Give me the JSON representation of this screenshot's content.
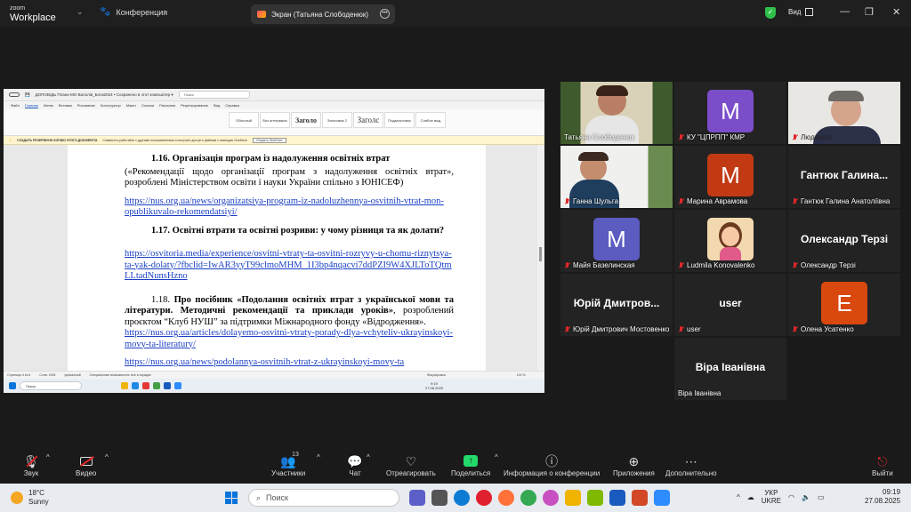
{
  "titlebar": {
    "brand_line1": "zoom",
    "brand_line2": "Workplace",
    "conference_tab": "Конференция",
    "share_tab": "Экран (Татьяна Слободенюк)",
    "view_label": "Вид"
  },
  "word": {
    "title": "ДОПОВІДЬ Плани МО Валолів_Блок2024 • Сохранено в этот компьютер ▾",
    "search": "Поиск",
    "tabs": [
      "Файл",
      "Главная",
      "Меню",
      "Вставка",
      "Рисование",
      "Конструктор",
      "Макет",
      "Ссылки",
      "Рассылки",
      "Рецензирование",
      "Вид",
      "Справка"
    ],
    "active_tab": "Главная",
    "styles": [
      "Обычный",
      "Без интервала",
      "Заголо",
      "Заголовок 2",
      "Заголс",
      "Подзаголовок",
      "Слабое выд"
    ],
    "banner_bold": "СОЗДАТЬ РЕЗЕРВНУЮ КОПИЮ ЭТОГО ДОКУМЕНТА",
    "banner_text": "Совместно работайте с другими пользователями и получите доступ к файлам с помощью OneDrive",
    "banner_btn": "Открыть OneDrive",
    "status_left": "Страница 4 из 6",
    "status_words": "Слов: 1905",
    "status_lang": "украинский",
    "status_access": "Специальные возможности: все в порядке",
    "status_focus": "Фокусировка",
    "status_zoom": "100 %",
    "inner_search": "Поиск",
    "inner_time": "9:19",
    "inner_date": "27.08.2025",
    "doc": {
      "h16": "1.16. Організація програм із надолуження освітніх втрат",
      "p16": "(«Рекомендації щодо організації програм з надолуження освітніх втрат», розроблені Міністерством освіти і науки України спільно з ЮНІСЕФ)",
      "l16": "https://nus.org.ua/news/organizatsiya-program-iz-nadoluzhennya-osvitnih-vtrat-mon-opublikuvalo-rekomendatsiyi/",
      "h17": "1.17. Освітні втрати та освітні розриви: у чому різниця та як долати?",
      "l17": "https://osvitoria.media/experience/osvitni-vtraty-ta-osvitni-rozryvy-u-chomu-riznytsya-ta-yak-dolaty/?fbclid=IwAR3yyT99clmoMHM_1I3bp4nqacvi7ddPZI9W4XJLToTQtmLLtadNunsHzno",
      "n18": "1.18.",
      "b18": "Про посібник «Подолання освітніх втрат з української мови та літератури. Методичні рекомендації та приклади уроків»",
      "t18": ", розроблений проєктом “Клуб НУШ” за підтримки Міжнародного фонду «Відродження».",
      "l18": "https://nus.org.ua/articles/dolayemo-osvitni-vtraty-porady-dlya-vchyteliv-ukrayinskoyi-movy-ta-literatury/",
      "l19": "https://nus.org.ua/news/podolannya-osvitnih-vtrat-z-ukrayinskoyi-movy-ta"
    }
  },
  "participants": [
    {
      "name": "Татьяна Слободенюк",
      "type": "photo",
      "color": "#7aa060"
    },
    {
      "name": "КУ \"ЦПРПП\" КМР",
      "type": "avatar",
      "letter": "M",
      "color": "#7b4dc9"
    },
    {
      "name": "Людмила",
      "type": "photo",
      "color": "#d9d0cc"
    },
    {
      "name": "Ганна Шульга",
      "type": "photo",
      "color": "#6d8a98"
    },
    {
      "name": "Марина Аврамова",
      "type": "avatar",
      "letter": "M",
      "color": "#c13a14"
    },
    {
      "name": "Гантюк Галина Анатоліївна",
      "type": "text",
      "big": "Гантюк  Галина..."
    },
    {
      "name": "Майя Базелинская",
      "type": "avatar",
      "letter": "M",
      "color": "#5b5bc0"
    },
    {
      "name": "Ludmila Konovalenko",
      "type": "cartoon",
      "color": "#f2d9b0"
    },
    {
      "name": "Олександр Терзі",
      "type": "text",
      "big": "Олександр Терзі"
    },
    {
      "name": "Юрій Дмитрович Мостовенко",
      "type": "text",
      "big": "Юрій  Дмитров..."
    },
    {
      "name": "user",
      "type": "text",
      "big": "user"
    },
    {
      "name": "Олена Усатенко",
      "type": "avatar",
      "letter": "E",
      "color": "#d9480f"
    },
    {
      "name": "Віра Іванівна",
      "type": "text",
      "big": "Віра Іванівна"
    }
  ],
  "toolbar": {
    "audio": "Звук",
    "video": "Видео",
    "participants": "Участники",
    "participants_count": "13",
    "chat": "Чат",
    "react": "Отреагировать",
    "share": "Поделиться",
    "info": "Информация о конференции",
    "apps": "Приложения",
    "more": "Дополнительно",
    "leave": "Выйти"
  },
  "taskbar": {
    "temp": "18°C",
    "weather": "Sunny",
    "search": "Поиск",
    "lang1": "УКР",
    "lang2": "UKRE",
    "time": "09:19",
    "date": "27.08.2025"
  }
}
